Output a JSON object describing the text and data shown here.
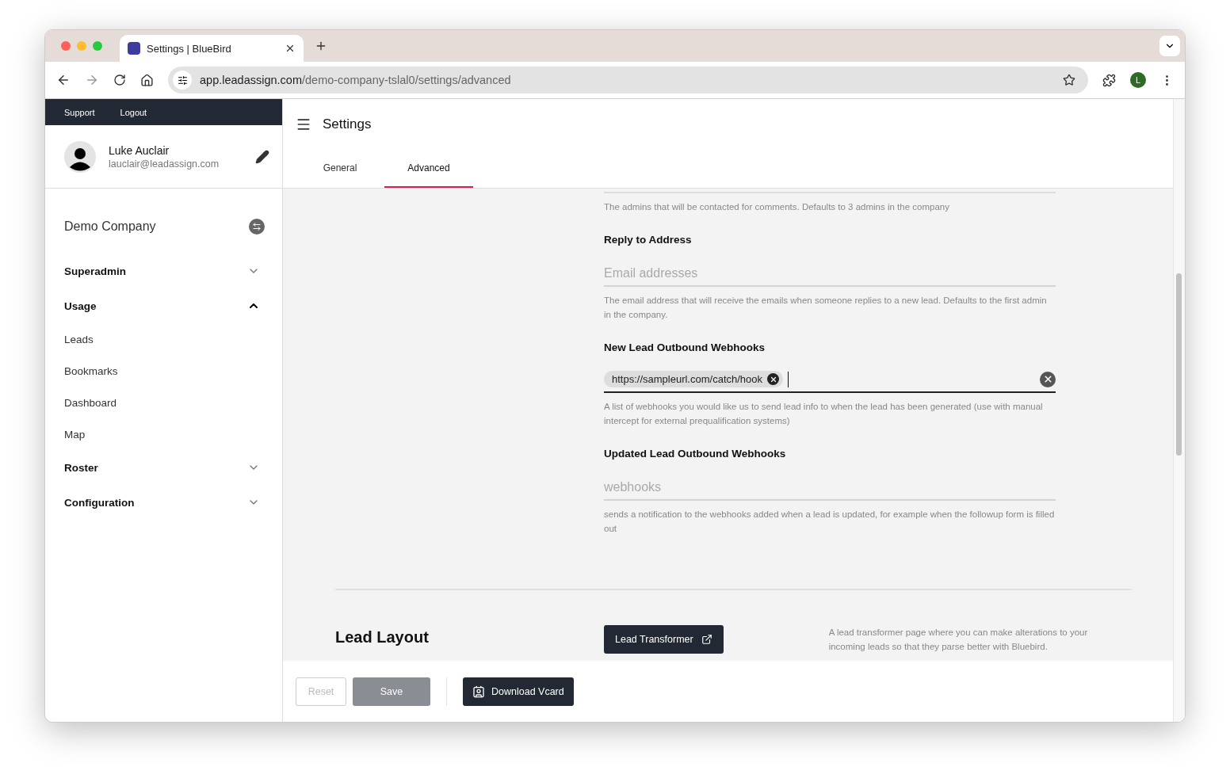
{
  "browser": {
    "tab": {
      "title": "Settings | BlueBird"
    },
    "url": {
      "host": "app.leadassign.com",
      "path": "/demo-company-tslal0/settings/advanced"
    },
    "profile_initial": "L"
  },
  "sidebar": {
    "top_links": [
      "Support",
      "Logout"
    ],
    "user": {
      "name": "Luke Auclair",
      "email": "lauclair@leadassign.com"
    },
    "company": "Demo Company",
    "nav": [
      {
        "label": "Superadmin",
        "expanded": false
      },
      {
        "label": "Usage",
        "expanded": true,
        "children": [
          {
            "label": "Leads"
          },
          {
            "label": "Bookmarks"
          },
          {
            "label": "Dashboard"
          },
          {
            "label": "Map"
          }
        ]
      },
      {
        "label": "Roster",
        "expanded": false
      },
      {
        "label": "Configuration",
        "expanded": false
      }
    ]
  },
  "header": {
    "title": "Settings",
    "tabs": [
      {
        "label": "General",
        "selected": false
      },
      {
        "label": "Advanced",
        "selected": true
      }
    ]
  },
  "fields": [
    {
      "kind": "cut",
      "help": "The admins that will be contacted for comments. Defaults to 3 admins in the company"
    },
    {
      "kind": "text",
      "label": "Reply to Address",
      "placeholder": "Email addresses",
      "help": "The email address that will receive the emails when someone replies to a new lead. Defaults to the first admin in the company."
    },
    {
      "kind": "chips",
      "label": "New Lead Outbound Webhooks",
      "chips": [
        "https://sampleurl.com/catch/hook"
      ],
      "help": "A list of webhooks you would like us to send lead info to when the lead has been generated (use with manual intercept for external prequalification systems)"
    },
    {
      "kind": "text",
      "label": "Updated Lead Outbound Webhooks",
      "placeholder": "webhooks",
      "help": "sends a notification to the webhooks added when a lead is updated, for example when the followup form is filled out"
    }
  ],
  "lead_layout": {
    "title": "Lead Layout",
    "button": "Lead Transformer",
    "description": "A lead transformer page where you can make alterations to your incoming leads so that they parse better with Bluebird."
  },
  "footer": {
    "buttons": [
      {
        "label": "Reset",
        "kind": "outline",
        "disabled": true
      },
      {
        "label": "Save",
        "kind": "solid",
        "disabled": true
      },
      {
        "label": "Download Vcard",
        "kind": "vcard",
        "disabled": false
      }
    ]
  }
}
